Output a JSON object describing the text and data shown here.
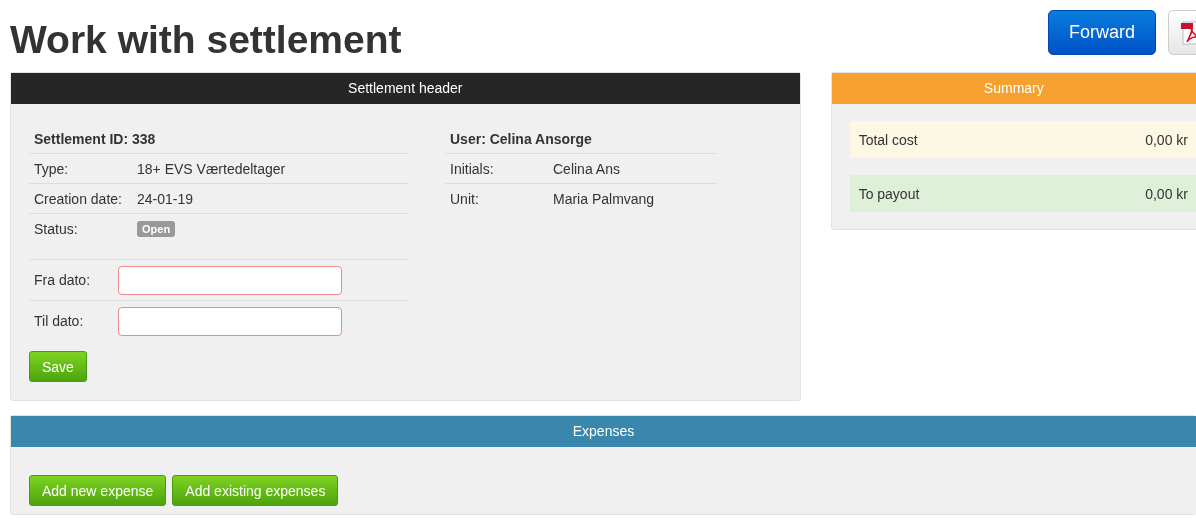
{
  "title": "Work with settlement",
  "actions": [
    {
      "kind": "primary",
      "label": "Forward"
    },
    {
      "kind": "pdf"
    }
  ],
  "settlement_header": {
    "title": "Settlement header",
    "left": {
      "heading": "Settlement ID: 338",
      "rows": [
        {
          "label": "Type:",
          "value": "18+ EVS Værtedeltager"
        },
        {
          "label": "Creation date:",
          "value": "24-01-19"
        },
        {
          "label": "Status:",
          "badge": "Open"
        }
      ]
    },
    "right": {
      "heading": "User: Celina Ansorge",
      "rows": [
        {
          "label": "Initials:",
          "value": "Celina Ans"
        },
        {
          "label": "Unit:",
          "value": "Maria Palmvang"
        }
      ]
    },
    "fields": [
      {
        "label": "Fra dato:",
        "invalid": true
      },
      {
        "label": "Til dato:",
        "invalid": true
      }
    ],
    "save_button": "Save"
  },
  "summary": {
    "title": "Summary",
    "rows": [
      {
        "label": "Total cost",
        "value": "0,00 kr",
        "color": "#fcf8e3"
      },
      {
        "label": "To payout",
        "value": "0,00 kr",
        "color": "#dff0d8"
      }
    ]
  },
  "expenses": {
    "title": "Expenses",
    "buttons": [
      "Add new expense",
      "Add existing expenses"
    ]
  }
}
